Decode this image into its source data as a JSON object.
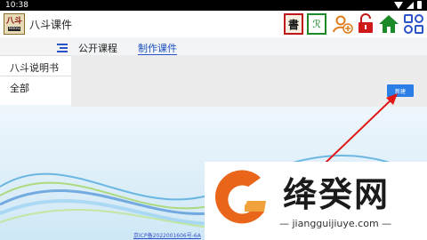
{
  "status": {
    "time": "10:38"
  },
  "app": {
    "logo_text": "八斗",
    "logo_sub": "8dou",
    "title": "八斗课件"
  },
  "toolbar": {
    "shu_label": "書",
    "sign_label": "ℛ",
    "colors": {
      "red": "#c01818",
      "green": "#1d8a2a",
      "orange": "#e07b1a",
      "blue": "#2a52c9"
    }
  },
  "sidebar": {
    "items": [
      {
        "label": "八斗说明书"
      },
      {
        "label": "全部"
      }
    ]
  },
  "tabs": [
    {
      "label": "公开课程",
      "active": false
    },
    {
      "label": "制作课件",
      "active": true
    }
  ],
  "main": {
    "new_button_label": "新建"
  },
  "footer": {
    "icp": "京ICP备2022001606号-6A"
  },
  "watermark": {
    "name": "绛癸网",
    "url": "jiangguijiuye.com"
  }
}
